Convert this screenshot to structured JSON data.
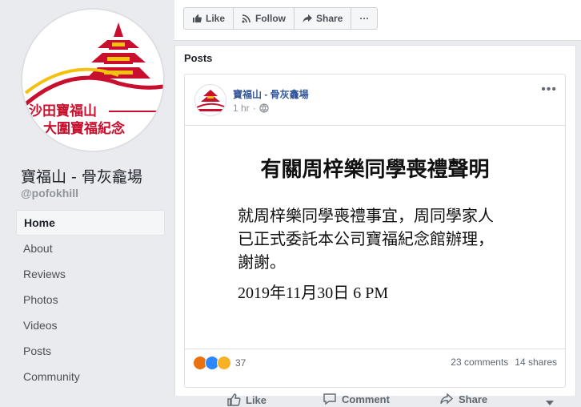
{
  "page": {
    "name": "寶福山 - 骨灰龕場",
    "handle": "@pofokhill",
    "logo_text_line1": "沙田寶福山",
    "logo_text_line2": "大圍寶福紀念"
  },
  "nav": {
    "items": [
      {
        "label": "Home",
        "active": true
      },
      {
        "label": "About"
      },
      {
        "label": "Reviews"
      },
      {
        "label": "Photos"
      },
      {
        "label": "Videos"
      },
      {
        "label": "Posts"
      },
      {
        "label": "Community"
      }
    ]
  },
  "topbar": {
    "like_label": "Like",
    "follow_label": "Follow",
    "share_label": "Share",
    "more_label": "···"
  },
  "posts": {
    "title": "Posts",
    "post": {
      "author": "寶福山 - 骨灰龕場",
      "time": "1 hr",
      "more": "•••",
      "image_headline": "有關周梓樂同學喪禮聲明",
      "image_body_line1": "就周梓樂同學喪禮事宜，周同學家人",
      "image_body_line2": "已正式委託本公司寶福紀念館辦理，",
      "image_body_line3": "謝謝。",
      "image_date": "2019年11月30日 6 PM",
      "reaction_count": "37",
      "comments": "23 comments",
      "shares": "14 shares",
      "like_label": "Like",
      "comment_label": "Comment",
      "share_label": "Share"
    }
  },
  "colors": {
    "brand_red": "#c8102e",
    "brand_yellow": "#f4c10f",
    "link_blue": "#365899"
  }
}
